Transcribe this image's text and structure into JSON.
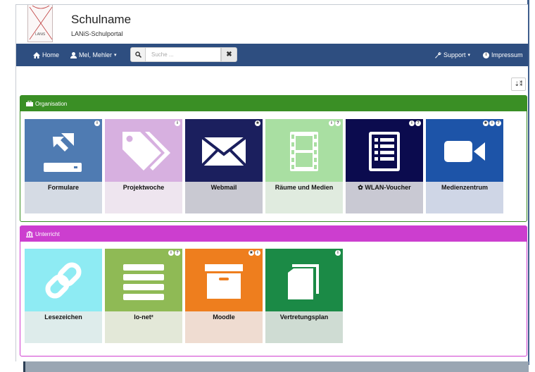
{
  "header": {
    "logo_text": "LANiS",
    "title": "Schulname",
    "subtitle": "LANiS-Schulportal"
  },
  "navbar": {
    "home": "Home",
    "user": "Mel, Mehler",
    "search_placeholder": "Suche ...",
    "support": "Support",
    "impressum": "Impressum"
  },
  "panels": {
    "organisation": {
      "title": "Organisation",
      "color": "#3a8f25",
      "tiles": [
        {
          "label": "Formulare",
          "icon": "form-upload-icon",
          "top": "#4f7bb2",
          "bottom": "#d5dbe4",
          "badges": [
            "i"
          ]
        },
        {
          "label": "Projektwoche",
          "icon": "tags-icon",
          "top": "#d7b0e0",
          "bottom": "#eee5ef",
          "badges": [
            "i"
          ]
        },
        {
          "label": "Webmail",
          "icon": "envelope-icon",
          "top": "#1b1f5e",
          "bottom": "#c9c9d2",
          "badges": [
            "★"
          ]
        },
        {
          "label": "Räume und Medien",
          "icon": "film-icon",
          "top": "#a9dfa2",
          "bottom": "#e0ebdf",
          "badges": [
            "i",
            "?"
          ]
        },
        {
          "label": "WLAN-Voucher",
          "icon": "list-icon",
          "top": "#0b0b4e",
          "bottom": "#c9c9d3",
          "badges": [
            "i",
            "?"
          ]
        },
        {
          "label": "Medienzentrum",
          "icon": "video-camera-icon",
          "top": "#1d54a8",
          "bottom": "#cfd6e6",
          "badges": [
            "★",
            "i",
            "?"
          ]
        }
      ]
    },
    "unterricht": {
      "title": "Unterricht",
      "color": "#cc3ecf",
      "tiles": [
        {
          "label": "Lesezeichen",
          "icon": "link-icon",
          "top": "#8eebf3",
          "bottom": "#deeceb",
          "badges": []
        },
        {
          "label": "lo-net²",
          "icon": "lines-icon",
          "top": "#8fba55",
          "bottom": "#e3e8d8",
          "badges": [
            "i",
            "?"
          ]
        },
        {
          "label": "Moodle",
          "icon": "archive-icon",
          "top": "#ee7e1e",
          "bottom": "#efdcd1",
          "badges": [
            "★",
            "i"
          ]
        },
        {
          "label": "Vertretungsplan",
          "icon": "copy-icon",
          "top": "#1b8a46",
          "bottom": "#cfdcd3",
          "badges": [
            "i"
          ]
        }
      ]
    }
  }
}
